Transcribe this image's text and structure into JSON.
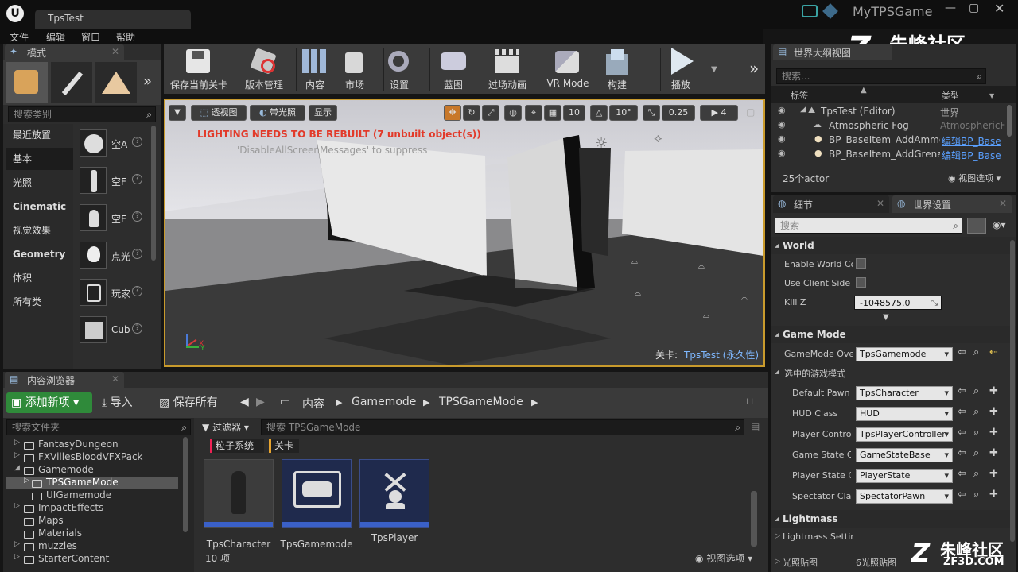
{
  "window": {
    "tab_title": "TpsTest",
    "project_name": "MyTPSGame"
  },
  "watermark": {
    "brand": "朱峰社区",
    "url": "ZF3D.COM"
  },
  "menu": [
    "文件",
    "编辑",
    "窗口",
    "帮助"
  ],
  "modes_panel": {
    "tab": "模式",
    "search_placeholder": "搜索类别",
    "categories": [
      "最近放置",
      "基本",
      "光照",
      "Cinematic",
      "视觉效果",
      "Geometry",
      "体积",
      "所有类"
    ],
    "items": [
      {
        "name": "空A",
        "icon": "sphere-icon"
      },
      {
        "name": "空F",
        "icon": "mannequin-icon"
      },
      {
        "name": "空F",
        "icon": "pawn-icon"
      },
      {
        "name": "点光",
        "icon": "lightbulb-icon"
      },
      {
        "name": "玩家",
        "icon": "player-start-icon"
      },
      {
        "name": "Cub",
        "icon": "cube-icon"
      }
    ]
  },
  "toolbar": {
    "buttons": [
      "保存当前关卡",
      "版本管理",
      "内容",
      "市场",
      "设置",
      "蓝图",
      "过场动画",
      "VR Mode",
      "构建",
      "播放"
    ]
  },
  "viewport": {
    "buttons": [
      "透视图",
      "带光照",
      "显示"
    ],
    "grid_value": "10",
    "rotate_value": "10°",
    "scale_value": "0.25",
    "camera_speed": "4",
    "warning": "LIGHTING NEEDS TO BE REBUILT (7 unbuilt object(s))",
    "subwarning": "'DisableAllScreenMessages' to suppress",
    "level_label": "关卡:",
    "level_name": "TpsTest (永久性)"
  },
  "outliner": {
    "tab": "世界大纲视图",
    "search_placeholder": "搜索...",
    "col_label": "标签",
    "col_type": "类型",
    "rows": [
      {
        "label": "TpsTest (Editor)",
        "type": "世界",
        "link": false
      },
      {
        "label": "Atmospheric Fog",
        "type": "AtmosphericF",
        "link": false
      },
      {
        "label": "BP_BaseItem_AddAmmo",
        "type": "编辑BP_Base",
        "link": true
      },
      {
        "label": "BP_BaseItem_AddGrenad",
        "type": "编辑BP_Base",
        "link": true
      }
    ],
    "count": "25个actor",
    "view_options": "视图选项"
  },
  "details": {
    "tab_details": "细节",
    "tab_world_settings": "世界设置",
    "search_placeholder": "搜索",
    "sections": {
      "world": "World",
      "game_mode": "Game Mode",
      "selected_game_mode": "选中的游戏模式",
      "lightmass": "Lightmass"
    },
    "world_props": [
      {
        "label": "Enable World Cor"
      },
      {
        "label": "Use Client Side L"
      }
    ],
    "kill_z_label": "Kill Z",
    "kill_z_value": "-1048575.0",
    "gamemode_override_label": "GameMode Over",
    "gamemode_override_value": "TpsGamemode",
    "selected_props": [
      {
        "label": "Default Pawn C",
        "value": "TpsCharacter"
      },
      {
        "label": "HUD Class",
        "value": "HUD"
      },
      {
        "label": "Player Controll",
        "value": "TpsPlayerController"
      },
      {
        "label": "Game State Cl",
        "value": "GameStateBase"
      },
      {
        "label": "Player State Cl",
        "value": "PlayerState"
      },
      {
        "label": "Spectator Clas",
        "value": "SpectatorPawn"
      }
    ],
    "lightmass_settings": "Lightmass Settir",
    "lightmap_label": "光照贴图",
    "lightmap_value": "6光照贴图"
  },
  "content_browser": {
    "tab": "内容浏览器",
    "add_new": "添加新项",
    "import": "导入",
    "save_all": "保存所有",
    "breadcrumb": [
      "内容",
      "Gamemode",
      "TPSGameMode"
    ],
    "folder_search_placeholder": "搜索文件夹",
    "filters": "过滤器",
    "asset_search_placeholder": "搜索 TPSGameMode",
    "filter_chips": [
      "粒子系统",
      "关卡"
    ],
    "folders": [
      {
        "name": "FantasyDungeon",
        "depth": 0,
        "expand": "▷"
      },
      {
        "name": "FXVillesBloodVFXPack",
        "depth": 0,
        "expand": "▷"
      },
      {
        "name": "Gamemode",
        "depth": 0,
        "expand": "◢"
      },
      {
        "name": "TPSGameMode",
        "depth": 1,
        "expand": "▷",
        "selected": true
      },
      {
        "name": "UIGamemode",
        "depth": 1,
        "expand": ""
      },
      {
        "name": "ImpactEffects",
        "depth": 0,
        "expand": "▷"
      },
      {
        "name": "Maps",
        "depth": 0,
        "expand": ""
      },
      {
        "name": "Materials",
        "depth": 0,
        "expand": ""
      },
      {
        "name": "muzzles",
        "depth": 0,
        "expand": "▷"
      },
      {
        "name": "StarterContent",
        "depth": 0,
        "expand": "▷"
      }
    ],
    "assets": [
      {
        "name": "TpsCharacter",
        "icon": "character-icon"
      },
      {
        "name": "TpsGamemode",
        "icon": "gamepad-icon"
      },
      {
        "name": "TpsPlayer",
        "icon": "player-controller-icon"
      }
    ],
    "item_count": "10 项",
    "view_options": "视图选项"
  }
}
